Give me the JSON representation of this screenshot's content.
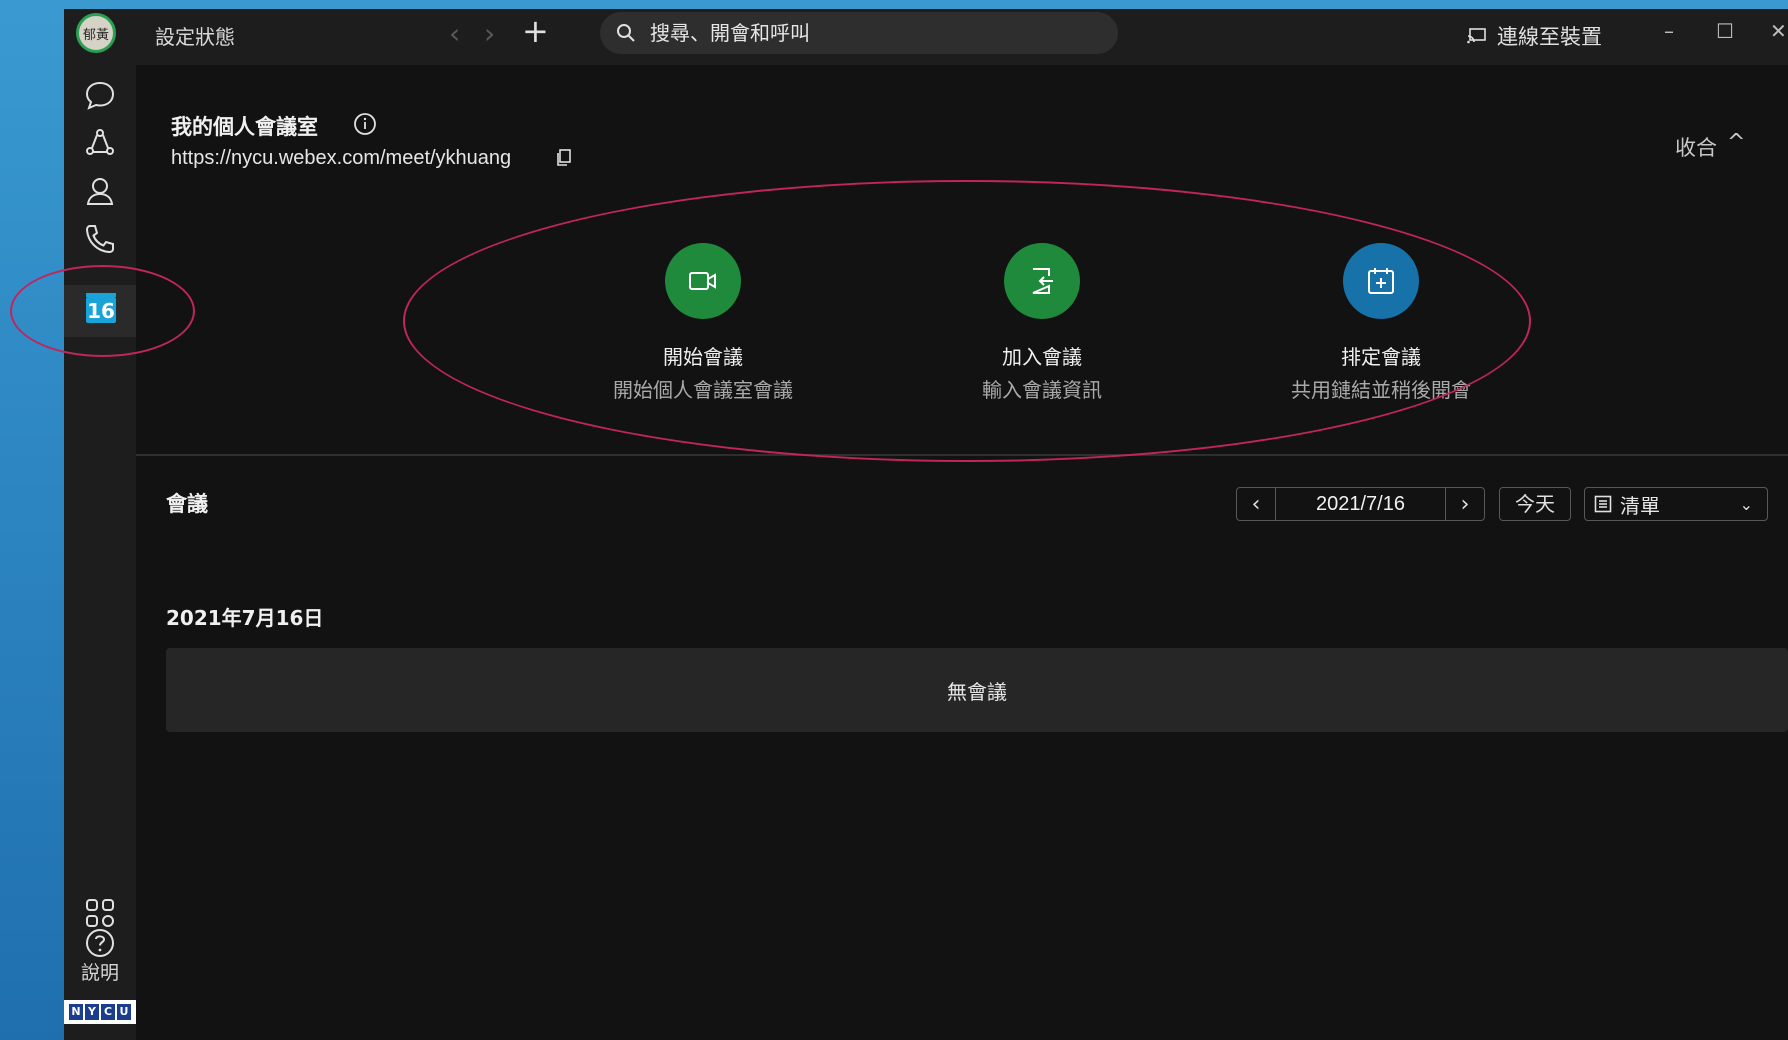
{
  "titlebar": {
    "avatar_initials": "郁黃",
    "status_label": "設定狀態",
    "search_placeholder": "搜尋、開會和呼叫",
    "connect_label": "連線至裝置"
  },
  "sidebar": {
    "calendar_day": "16",
    "help_label": "說明",
    "logo_letters": [
      "N",
      "Y",
      "C",
      "U"
    ]
  },
  "personal_room": {
    "title": "我的個人會議室",
    "url": "https://nycu.webex.com/meet/ykhuang",
    "collapse_label": "收合"
  },
  "actions": [
    {
      "label": "開始會議",
      "sub": "開始個人會議室會議",
      "color": "#1f8a3c"
    },
    {
      "label": "加入會議",
      "sub": "輸入會議資訊",
      "color": "#1f8a3c"
    },
    {
      "label": "排定會議",
      "sub": "共用鏈結並稍後開會",
      "color": "#1672a8"
    }
  ],
  "meetings": {
    "title": "會議",
    "date_value": "2021/7/16",
    "today_label": "今天",
    "view_selected": "清單",
    "day_heading": "2021年7月16日",
    "empty_label": "無會議"
  },
  "colors": {
    "annotation": "#c0255e",
    "calendar_accent": "#1aa3d8"
  }
}
